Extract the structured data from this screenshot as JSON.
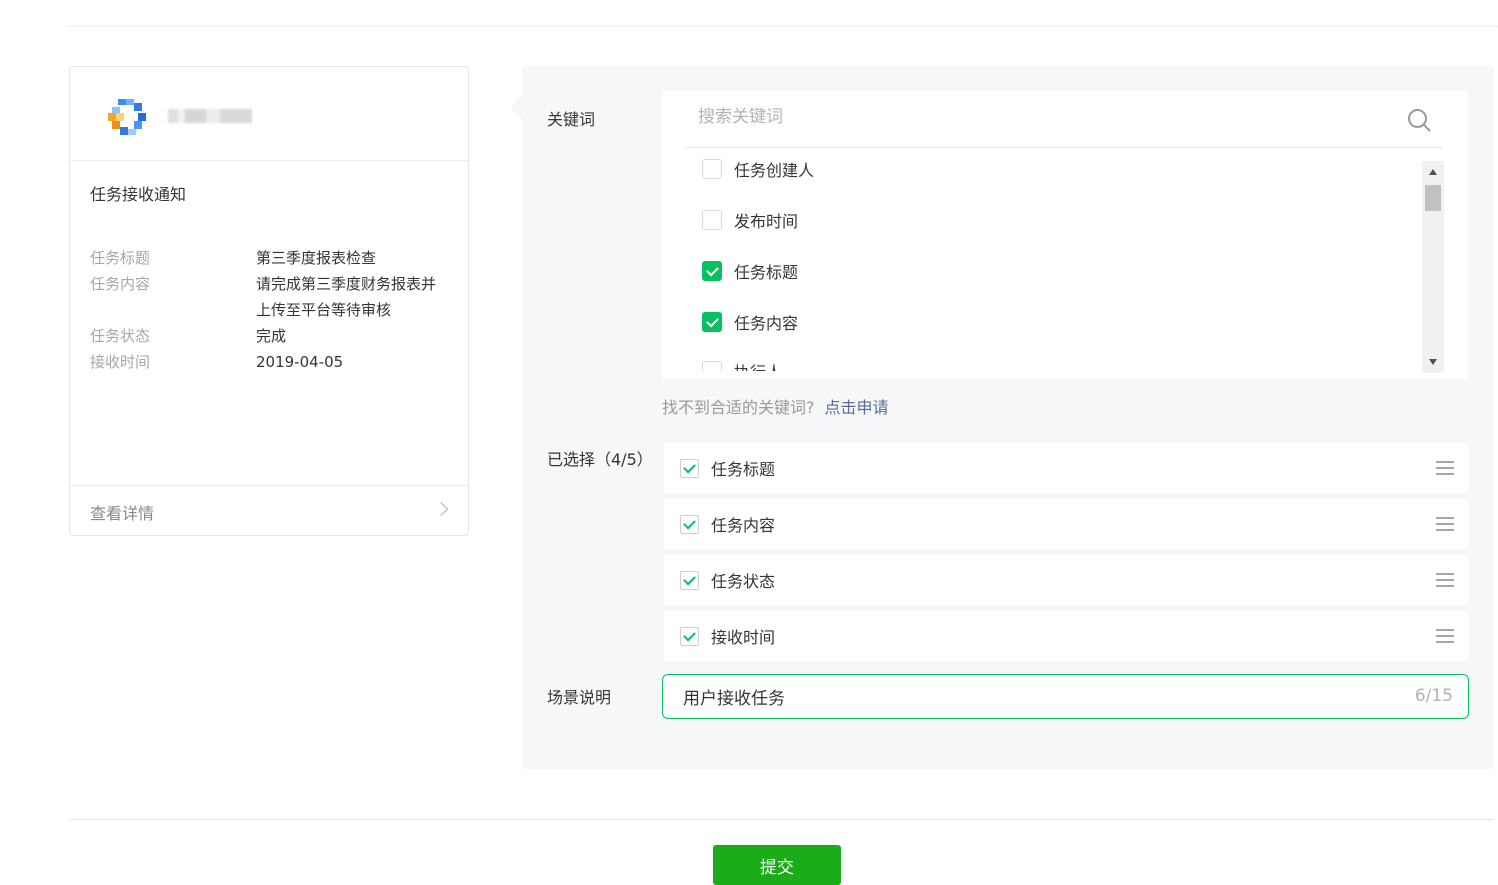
{
  "preview_card": {
    "account_name": "",
    "title": "任务接收通知",
    "fields": [
      {
        "label": "任务标题",
        "value": "第三季度报表检查"
      },
      {
        "label": "任务内容",
        "value": "请完成第三季度财务报表并上传至平台等待审核"
      },
      {
        "label": "任务状态",
        "value": "完成"
      },
      {
        "label": "接收时间",
        "value": "2019-04-05"
      }
    ],
    "detail_link": "查看详情"
  },
  "keywords": {
    "label": "关键词",
    "search_placeholder": "搜索关键词",
    "items": [
      {
        "label": "任务创建人",
        "checked": false
      },
      {
        "label": "发布时间",
        "checked": false
      },
      {
        "label": "任务标题",
        "checked": true
      },
      {
        "label": "任务内容",
        "checked": true
      },
      {
        "label": "执行人",
        "checked": false
      }
    ],
    "hint_text": "找不到合适的关键词?",
    "hint_link": "点击申请"
  },
  "selected": {
    "label": "已选择（4/5）",
    "items": [
      "任务标题",
      "任务内容",
      "任务状态",
      "接收时间"
    ]
  },
  "scene": {
    "label": "场景说明",
    "value": "用户接收任务",
    "counter": "6/15"
  },
  "submit_label": "提交",
  "colors": {
    "accent": "#07c160",
    "button": "#1aad19",
    "link": "#576b95",
    "panel_bg": "#f6f7f8"
  }
}
